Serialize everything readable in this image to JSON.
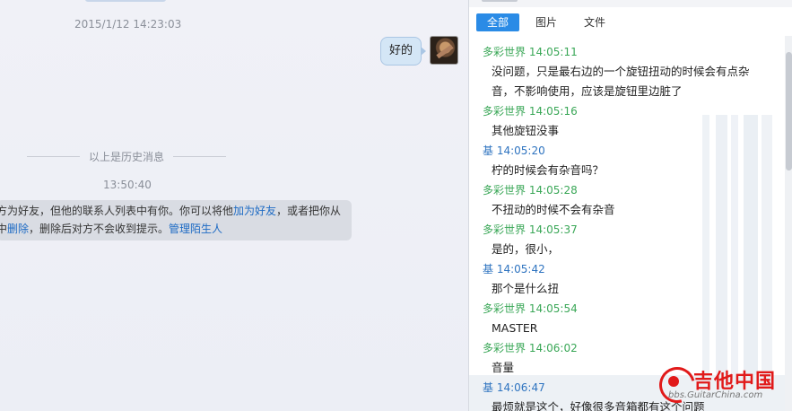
{
  "chat": {
    "timestamp_top": "2015/1/12 14:23:03",
    "sent_message": "好的",
    "history_divider": "以上是历史消息",
    "timestamp_notice": "13:50:40",
    "notice_line1_a": "方为好友，但他的联系人列表中有你。你可以将他",
    "notice_link_add": "加为好友",
    "notice_line1_b": "，或者把你从",
    "notice_line2_a": "中",
    "notice_link_delete": "删除",
    "notice_line2_b": "，删除后对方不会收到提示。",
    "notice_link_manage": "管理陌生人"
  },
  "history": {
    "tabs": [
      {
        "label": "全部",
        "active": true
      },
      {
        "label": "图片",
        "active": false
      },
      {
        "label": "文件",
        "active": false
      }
    ],
    "messages": [
      {
        "sender": "多彩世界",
        "time": "14:05:11",
        "color": "green",
        "lines": [
          "没问题，只是最右边的一个旋钮扭动的时候会有点杂",
          "音，不影响使用，应该是旋钮里边脏了"
        ]
      },
      {
        "sender": "多彩世界",
        "time": "14:05:16",
        "color": "green",
        "lines": [
          "其他旋钮没事"
        ]
      },
      {
        "sender": "基",
        "time": "14:05:20",
        "color": "blue",
        "lines": [
          "柠的时候会有杂音吗？"
        ]
      },
      {
        "sender": "多彩世界",
        "time": "14:05:28",
        "color": "green",
        "lines": [
          "不扭动的时候不会有杂音"
        ]
      },
      {
        "sender": "多彩世界",
        "time": "14:05:37",
        "color": "green",
        "lines": [
          "是的，很小，"
        ]
      },
      {
        "sender": "基",
        "time": "14:05:42",
        "color": "blue",
        "lines": [
          "那个是什么扭"
        ]
      },
      {
        "sender": "多彩世界",
        "time": "14:05:54",
        "color": "green",
        "lines": [
          "MASTER"
        ]
      },
      {
        "sender": "多彩世界",
        "time": "14:06:02",
        "color": "green",
        "lines": [
          "音量"
        ]
      },
      {
        "sender": "基",
        "time": "14:06:47",
        "color": "blue",
        "lines": [
          "最烦就是这个，好像很多音箱都有这个问题"
        ]
      }
    ]
  },
  "colors": {
    "accent": "#2a8be6",
    "green_sender": "#3aa757",
    "blue_sender": "#2f74c0",
    "link": "#1e6bc4"
  },
  "watermark": {
    "cn": "吉他中国",
    "en": "bbs.GuitarChina.com"
  }
}
